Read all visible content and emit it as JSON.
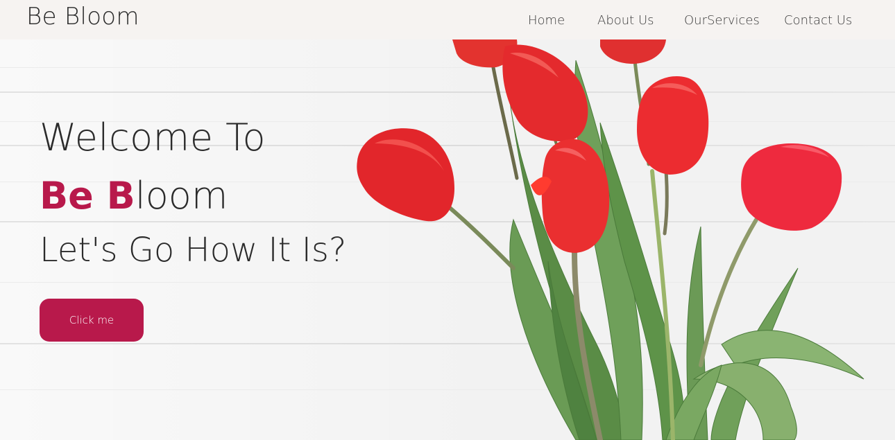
{
  "brand": {
    "name": "Be Bloom"
  },
  "nav": {
    "items": [
      {
        "label": "Home"
      },
      {
        "label": "About Us"
      },
      {
        "label": "OurServices"
      },
      {
        "label": "Contact Us"
      }
    ]
  },
  "hero": {
    "line1": "Welcome To",
    "line2_accent_1": "Be B",
    "line2_rest": "loom",
    "line3": "Let's Go How It Is?",
    "button_label": "Click me",
    "image": "red-tulips-bouquet"
  },
  "colors": {
    "accent": "#b8194b",
    "nav_background": "#f6f3f1",
    "text": "#2b2b2b",
    "tulip": "#e8262c",
    "leaf": "#5e8f4a"
  }
}
